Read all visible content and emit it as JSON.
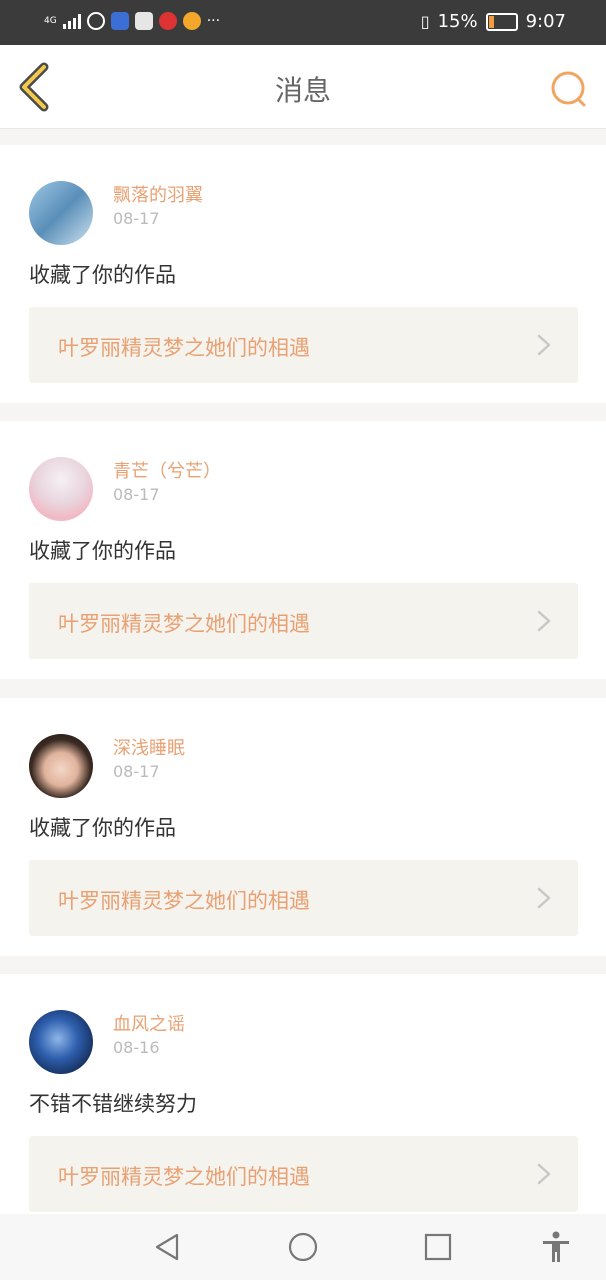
{
  "status_bar": {
    "network": "4G",
    "battery_percent": "15%",
    "time": "9:07",
    "notification_icons": [
      "k-app-icon",
      "baidu-icon",
      "video-app-icon",
      "netease-icon",
      "weibo-icon"
    ],
    "overflow": "···"
  },
  "header": {
    "title": "消息",
    "accent": "#f0a562"
  },
  "messages": [
    {
      "user": "飘落的羽翼",
      "date": "08-17",
      "text": "收藏了你的作品",
      "work_title": "叶罗丽精灵梦之她们的相遇",
      "avatar": "avatar-anime-blue"
    },
    {
      "user": "青芒（兮芒）",
      "date": "08-17",
      "text": "收藏了你的作品",
      "work_title": "叶罗丽精灵梦之她们的相遇",
      "avatar": "avatar-anime-white-hair"
    },
    {
      "user": "深浅睡眠",
      "date": "08-17",
      "text": "收藏了你的作品",
      "work_title": "叶罗丽精灵梦之她们的相遇",
      "avatar": "avatar-painted-woman"
    },
    {
      "user": "血风之谣",
      "date": "08-16",
      "text": "不错不错继续努力",
      "work_title": "叶罗丽精灵梦之她们的相遇",
      "avatar": "avatar-blue-beast"
    }
  ],
  "colors": {
    "username": "#e9a173",
    "work_bg": "#f4f3ee",
    "page_bg": "#f6f5f3"
  }
}
